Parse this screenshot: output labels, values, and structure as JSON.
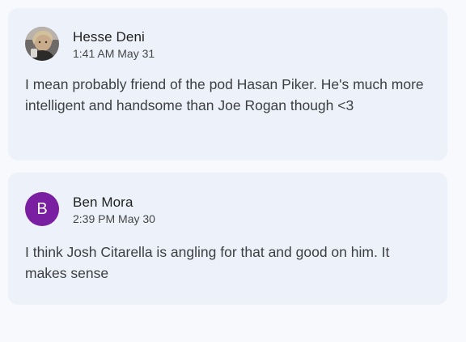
{
  "comments": [
    {
      "author": "Hesse Deni",
      "timestamp": "1:41 AM May 31",
      "avatar": {
        "type": "photo",
        "icon": "user-photo-icon"
      },
      "text": "I mean probably friend of the pod Hasan Piker. He's much more intelligent and handsome than Joe Rogan though <3"
    },
    {
      "author": "Ben Mora",
      "timestamp": "2:39 PM May 30",
      "avatar": {
        "type": "letter",
        "letter": "B",
        "color": "#7b1fa2"
      },
      "text": "I think Josh Citarella is angling for that and good on him. It makes sense"
    }
  ],
  "colors": {
    "card_background": "#edf1fa",
    "page_background": "#f8f9fc",
    "avatar_purple": "#7b1fa2"
  }
}
